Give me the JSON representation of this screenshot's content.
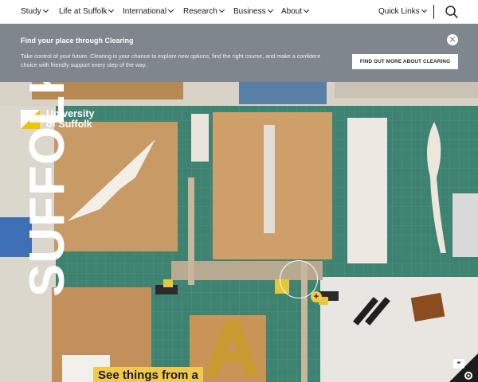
{
  "nav": {
    "items": [
      {
        "label": "Study"
      },
      {
        "label": "Life at Suffolk"
      },
      {
        "label": "International"
      },
      {
        "label": "Research"
      },
      {
        "label": "Business"
      },
      {
        "label": "About"
      }
    ],
    "quick_links": "Quick Links",
    "search_icon": "search-icon"
  },
  "banner": {
    "title": "Find your place through Clearing",
    "body": "Take control of your future. Clearing is your chance to explore new options, find the right course, and make a confident choice with friendly support every step of the way.",
    "cta": "FIND OUT MORE ABOUT CLEARING",
    "close_icon": "close-icon",
    "background": "#7f868d"
  },
  "hero": {
    "logo_line1": "University",
    "logo_line2": "of Suffolk",
    "big_word": "SUFFOLK",
    "cta_text": "See things from a",
    "hotspot_icon": "plus-icon",
    "accent": "#f2c94c",
    "cookie_icon": "cookie-settings-icon"
  }
}
